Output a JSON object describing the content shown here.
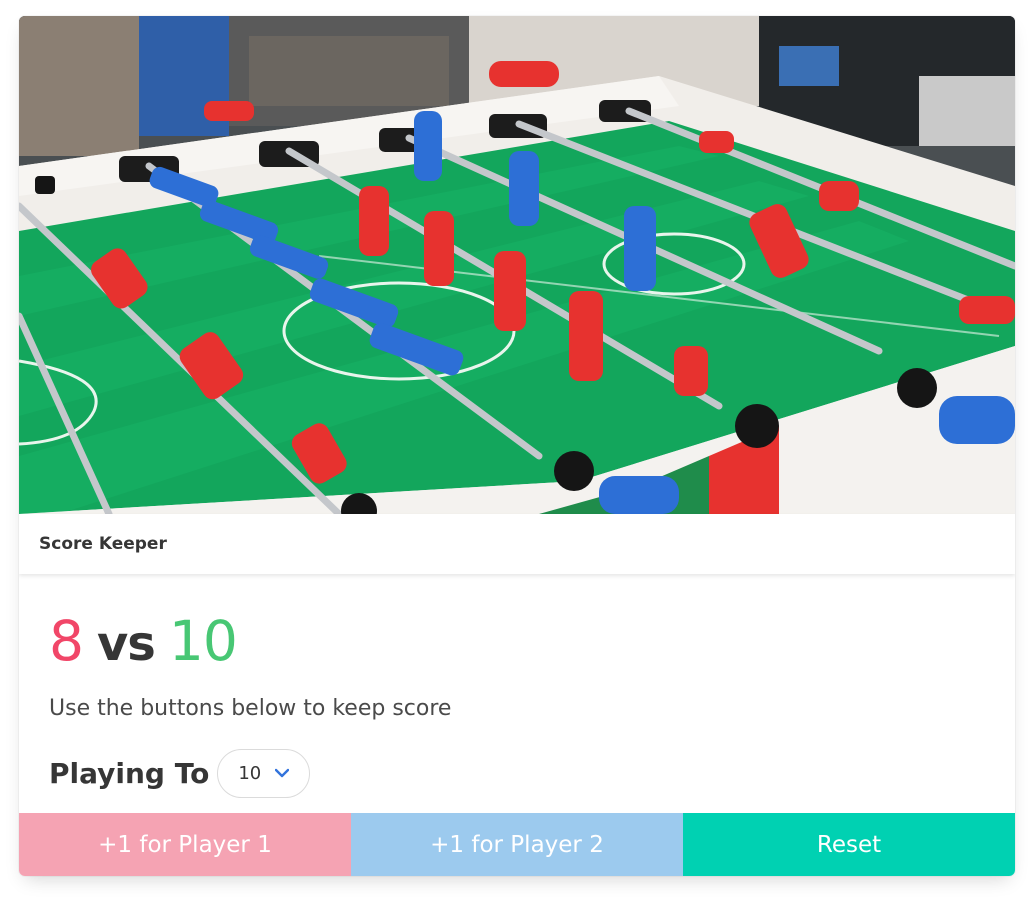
{
  "image": {
    "alt": "foosball table",
    "colors": {
      "pitch": "#12a35a",
      "red_player": "#e7322f",
      "blue_player": "#2d6fd6",
      "rod": "#b9bcc0"
    }
  },
  "header": {
    "title": "Score Keeper"
  },
  "scoreboard": {
    "player1_score": "8",
    "vs": "vs",
    "player2_score": "10",
    "subtitle": "Use the buttons below to keep score"
  },
  "playing_to": {
    "label": "Playing To",
    "selected": "10",
    "icon": "chevron-down-icon"
  },
  "buttons": {
    "player1": "+1 for Player 1",
    "player2": "+1 for Player 2",
    "reset": "Reset"
  },
  "colors": {
    "player1": "#f14668",
    "player2": "#48c774",
    "button_player1": "#f5a3b3",
    "button_player2": "#9ccaee",
    "button_reset": "#00d1b2",
    "dropdown_chevron": "#3273dc"
  }
}
